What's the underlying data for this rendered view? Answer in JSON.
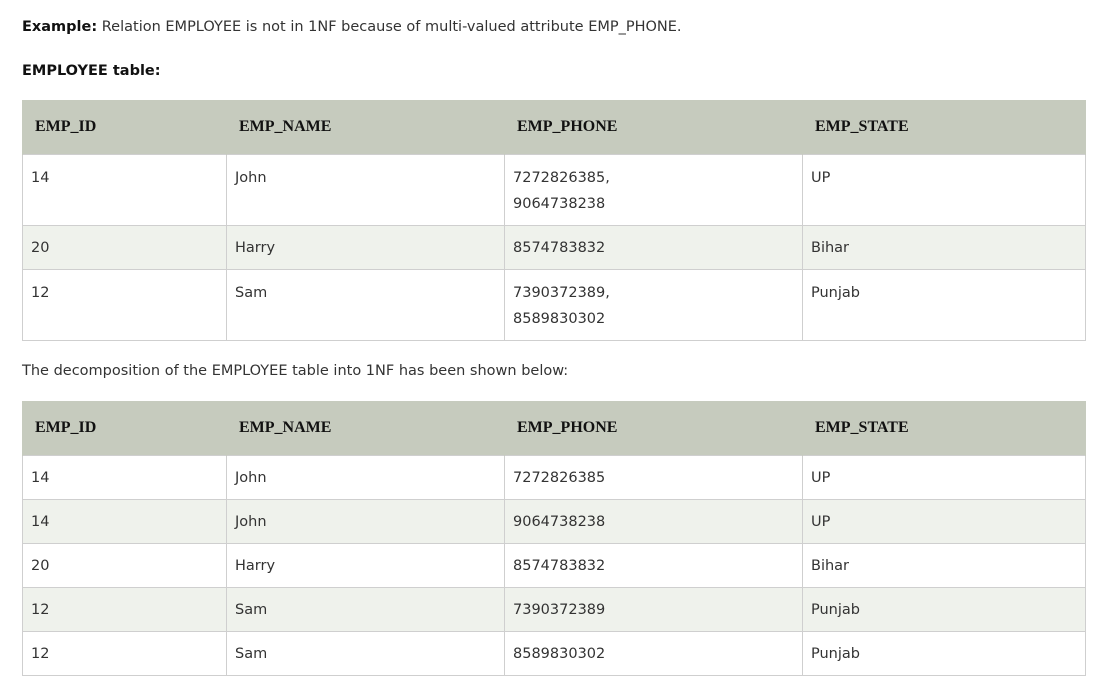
{
  "intro": {
    "example_label": "Example:",
    "example_text": " Relation EMPLOYEE is not in 1NF because of multi-valued attribute EMP_PHONE.",
    "table_caption": "EMPLOYEE table:",
    "decomposition_text": "The decomposition of the EMPLOYEE table into 1NF has been shown below:"
  },
  "table1": {
    "headers": [
      "EMP_ID",
      "EMP_NAME",
      "EMP_PHONE",
      "EMP_STATE"
    ],
    "rows": [
      {
        "id": "14",
        "name": "John",
        "phone_1": "7272826385,",
        "phone_2": "9064738238",
        "state": "UP"
      },
      {
        "id": "20",
        "name": "Harry",
        "phone_1": "8574783832",
        "phone_2": "",
        "state": "Bihar"
      },
      {
        "id": "12",
        "name": "Sam",
        "phone_1": "7390372389,",
        "phone_2": "8589830302",
        "state": "Punjab"
      }
    ]
  },
  "table2": {
    "headers": [
      "EMP_ID",
      "EMP_NAME",
      "EMP_PHONE",
      "EMP_STATE"
    ],
    "rows": [
      {
        "id": "14",
        "name": "John",
        "phone": "7272826385",
        "state": "UP"
      },
      {
        "id": "14",
        "name": "John",
        "phone": "9064738238",
        "state": "UP"
      },
      {
        "id": "20",
        "name": "Harry",
        "phone": "8574783832",
        "state": "Bihar"
      },
      {
        "id": "12",
        "name": "Sam",
        "phone": "7390372389",
        "state": "Punjab"
      },
      {
        "id": "12",
        "name": "Sam",
        "phone": "8589830302",
        "state": "Punjab"
      }
    ]
  },
  "colors": {
    "header_bg": "#c6cbbe",
    "stripe_bg": "#eff2ec",
    "border": "#cfcfcf"
  }
}
